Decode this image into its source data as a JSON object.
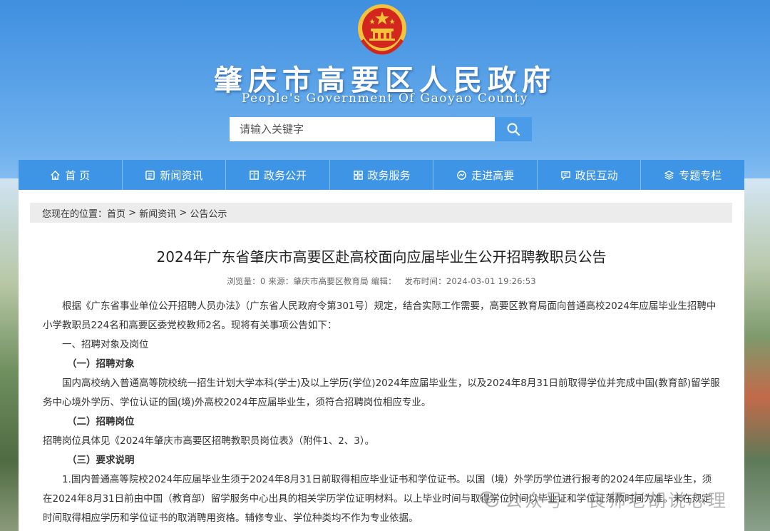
{
  "header": {
    "title": "肇庆市高要区人民政府",
    "subtitle": "People's Government Of Gaoyao County"
  },
  "search": {
    "placeholder": "请输入关键字"
  },
  "nav": {
    "items": [
      {
        "label": "首 页",
        "icon": "home-icon"
      },
      {
        "label": "新闻资讯",
        "icon": "news-icon"
      },
      {
        "label": "政务公开",
        "icon": "book-icon"
      },
      {
        "label": "政务服务",
        "icon": "grid-icon"
      },
      {
        "label": "走进高要",
        "icon": "gauge-icon"
      },
      {
        "label": "政民互动",
        "icon": "chat-icon"
      },
      {
        "label": "专题专栏",
        "icon": "layers-icon"
      }
    ]
  },
  "breadcrumb": {
    "prefix": "您现在的位置：",
    "items": [
      "首页",
      "新闻资讯",
      "公告公示"
    ],
    "separator": " > "
  },
  "article": {
    "title": "2024年广东省肇庆市高要区赴高校面向应届毕业生公开招聘教职员公告",
    "meta": {
      "views_label": "浏览量：",
      "views": "0",
      "source_label": "来源：",
      "source": "肇庆市高要区教育局",
      "editor_label": "编辑：",
      "time_label": "发布时间：",
      "time": "2024-03-01 19:26:53"
    },
    "paragraphs": [
      "根据《广东省事业单位公开招聘人员办法》（广东省人民政府令第301号）规定，结合实际工作需要，高要区教育局面向普通高校2024年应届毕业生招聘中小学教职员224名和高要区委党校教师2名。现将有关事项公告如下：",
      "一、招聘对象及岗位",
      "（一）招聘对象",
      "国内高校纳入普通高等院校统一招生计划大学本科(学士)及以上学历(学位)2024年应届毕业生，以及2024年8月31日前取得学位并完成中国(教育部)留学服务中心境外学历、学位认证的国(境)外高校2024年应届毕业生，须符合招聘岗位相应专业。",
      "（二）招聘岗位",
      "招聘岗位具体见《2024年肇庆市高要区招聘教职员岗位表》（附件1、2、3）。",
      "（三）要求说明",
      "1.国内普通高等院校2024年应届毕业生须于2024年8月31日前取得相应毕业证书和学位证书。以国（境）外学历学位进行报考的2024年应届毕业生，须在2024年8月31日前由中国（教育部）留学服务中心出具的相关学历学位证明材料。以上毕业时间与取得学位时间以毕业证和学位证落款时间为准。未在规定时间取得相应学历和学位证书的取消聘用资格。辅修专业、学位种类均不作为专业依据。"
    ]
  },
  "watermark": {
    "text": "公众号 · 良师老胡说心理"
  },
  "colors": {
    "nav": "#3e95e6",
    "search_button": "#4a9be8",
    "emblem_red": "#d2261f",
    "emblem_gold": "#f2c33b"
  }
}
